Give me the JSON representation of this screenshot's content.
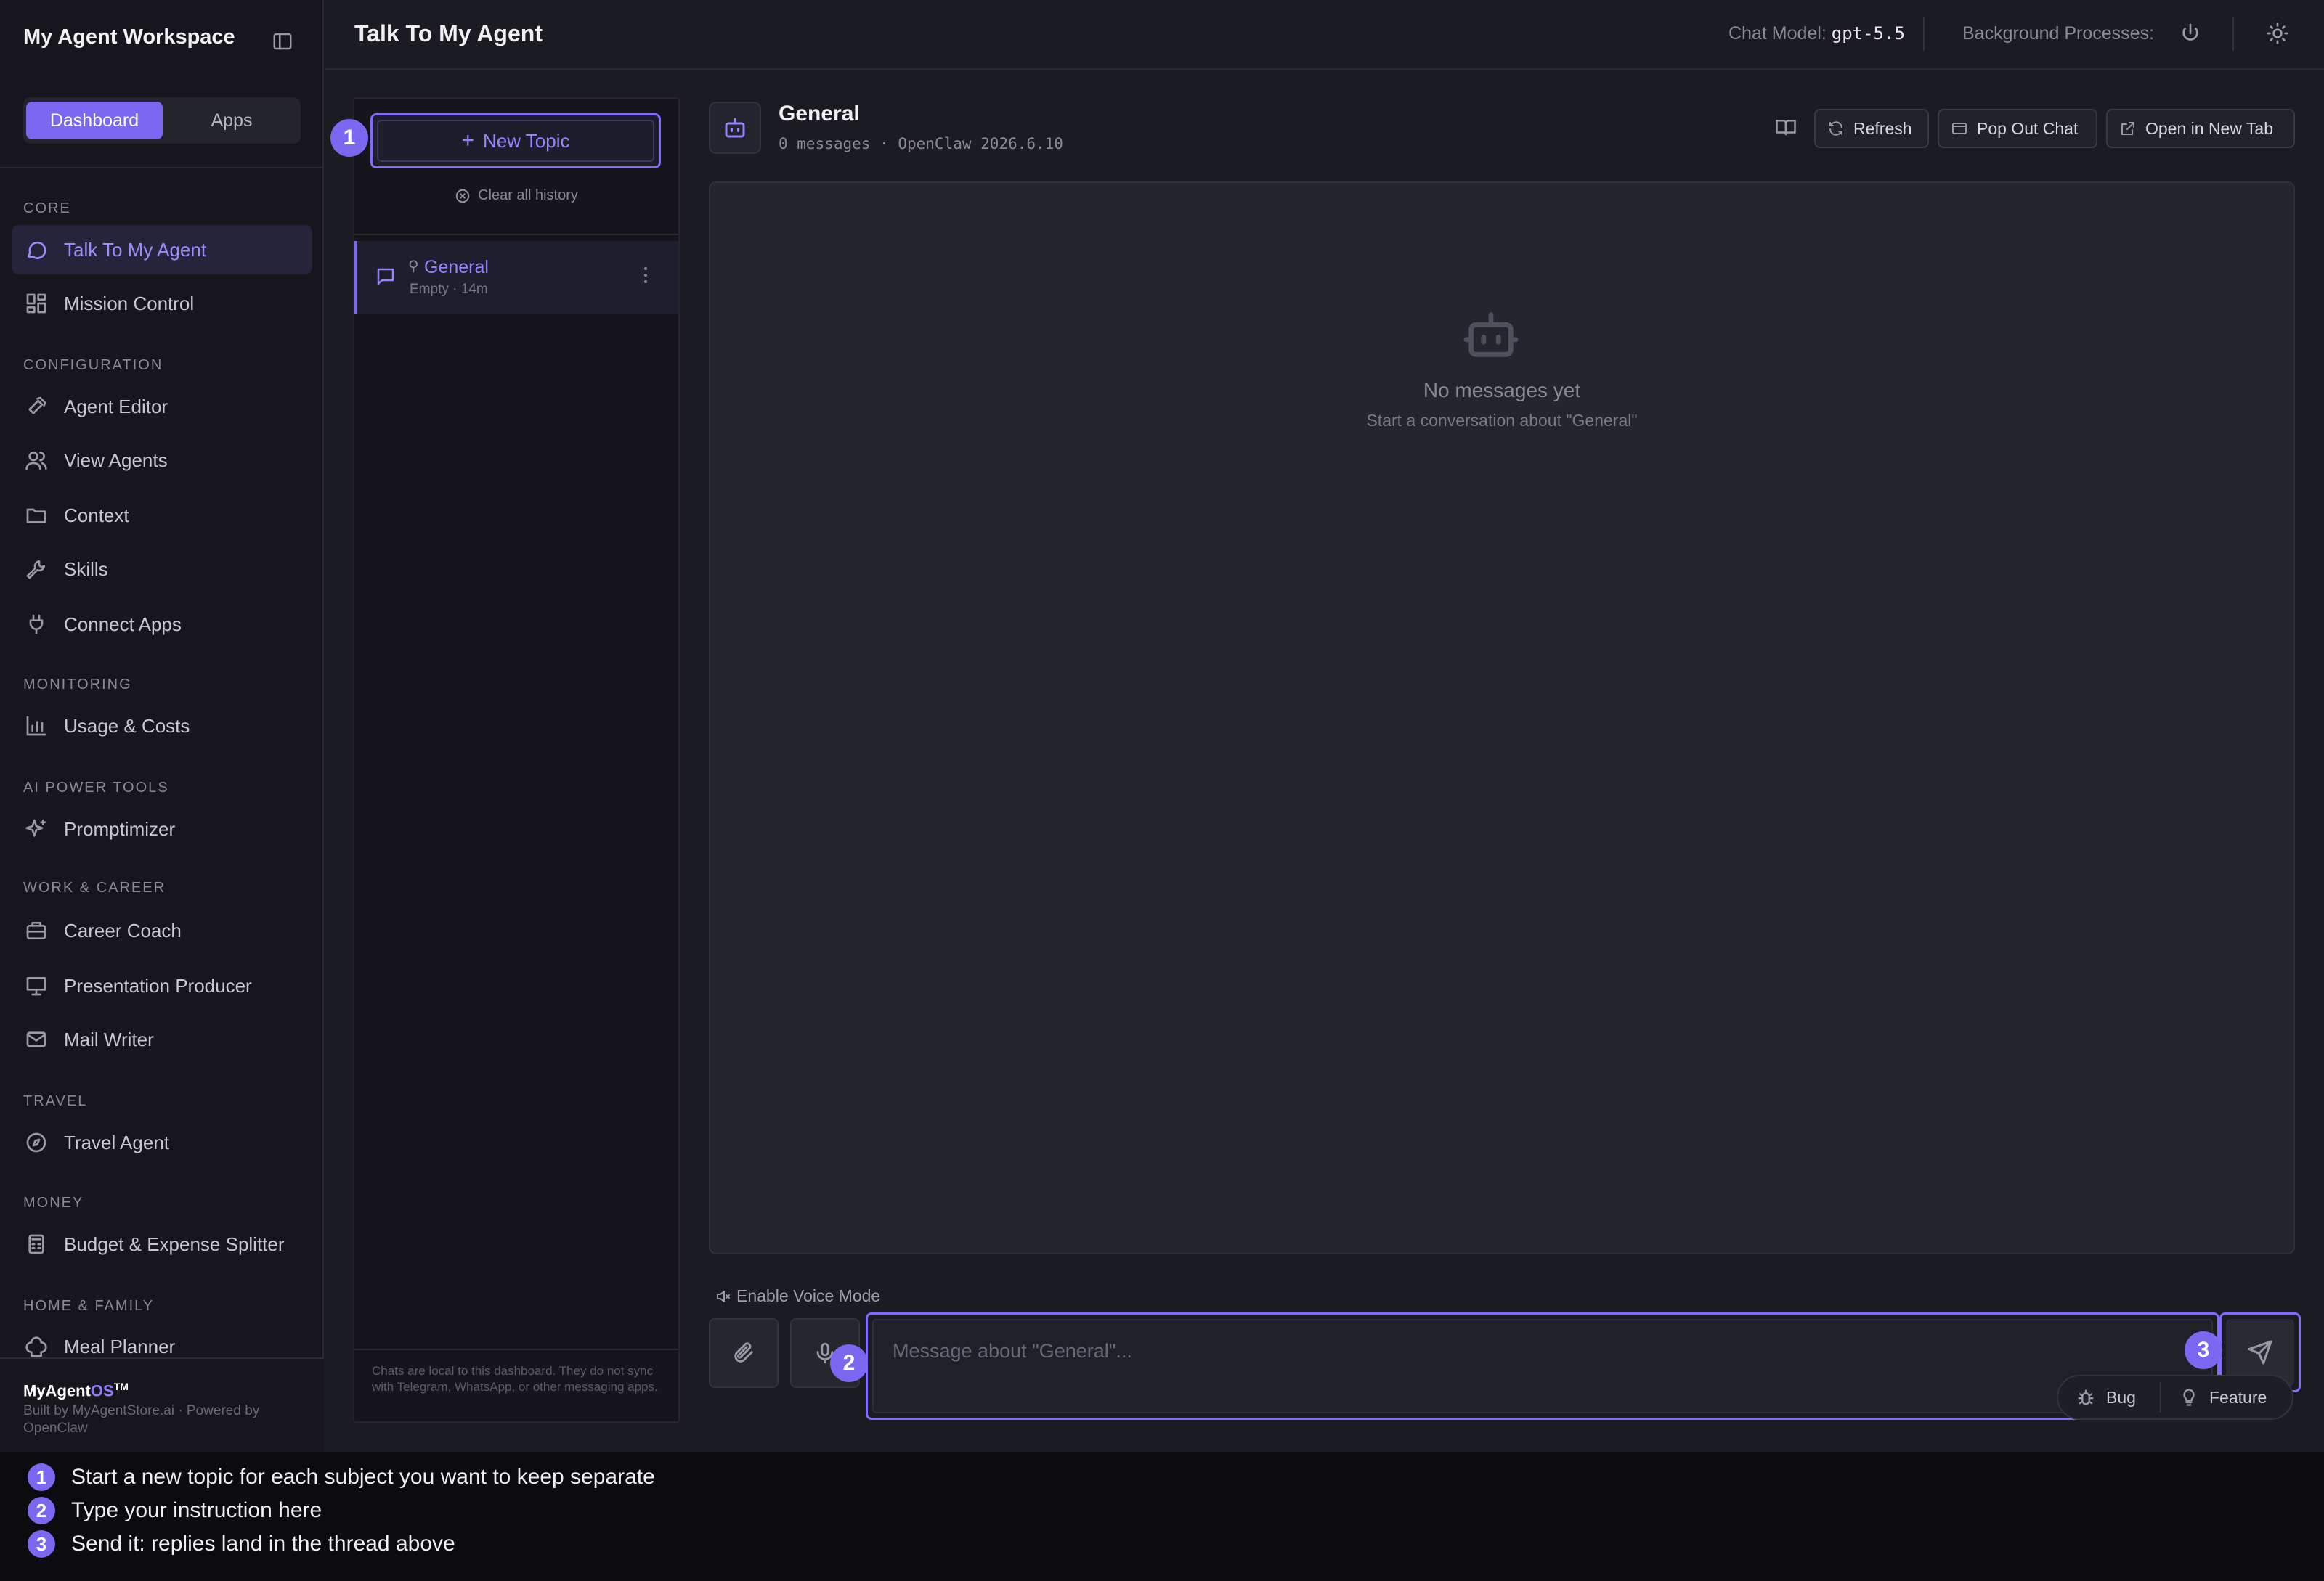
{
  "sidebar": {
    "title": "My Agent Workspace",
    "tabs": {
      "dashboard": "Dashboard",
      "apps": "Apps"
    },
    "sections": [
      {
        "label": "CORE",
        "items": [
          {
            "label": "Talk To My Agent",
            "icon": "message-icon",
            "active": true
          },
          {
            "label": "Mission Control",
            "icon": "grid-icon"
          }
        ]
      },
      {
        "label": "CONFIGURATION",
        "items": [
          {
            "label": "Agent Editor",
            "icon": "hammer-icon"
          },
          {
            "label": "View Agents",
            "icon": "users-icon"
          },
          {
            "label": "Context",
            "icon": "folder-icon"
          },
          {
            "label": "Skills",
            "icon": "wrench-icon"
          },
          {
            "label": "Connect Apps",
            "icon": "plug-icon"
          }
        ]
      },
      {
        "label": "MONITORING",
        "items": [
          {
            "label": "Usage & Costs",
            "icon": "bar-chart-icon"
          }
        ]
      },
      {
        "label": "AI POWER TOOLS",
        "items": [
          {
            "label": "Promptimizer",
            "icon": "sparkles-icon"
          }
        ]
      },
      {
        "label": "WORK & CAREER",
        "items": [
          {
            "label": "Career Coach",
            "icon": "briefcase-icon"
          },
          {
            "label": "Presentation Producer",
            "icon": "presentation-icon"
          },
          {
            "label": "Mail Writer",
            "icon": "mail-icon"
          }
        ]
      },
      {
        "label": "TRAVEL",
        "items": [
          {
            "label": "Travel Agent",
            "icon": "compass-icon"
          }
        ]
      },
      {
        "label": "MONEY",
        "items": [
          {
            "label": "Budget & Expense Splitter",
            "icon": "calculator-icon"
          }
        ]
      },
      {
        "label": "HOME & FAMILY",
        "items": [
          {
            "label": "Meal Planner",
            "icon": "chef-hat-icon"
          }
        ]
      }
    ],
    "footer": {
      "brand_main": "MyAgent",
      "brand_os": "OS",
      "brand_tm": "TM",
      "sub": "Built by MyAgentStore.ai · Powered by OpenClaw"
    }
  },
  "header": {
    "title": "Talk To My Agent",
    "chat_model_label": "Chat Model:",
    "chat_model_value": "gpt-5.5",
    "background_label": "Background Processes:"
  },
  "topics": {
    "new_topic": "New Topic",
    "clear_history": "Clear all history",
    "items": [
      {
        "name": "General",
        "sub": "Empty · 14m"
      }
    ],
    "note": "Chats are local to this dashboard. They do not sync with Telegram, WhatsApp, or other messaging apps."
  },
  "chat": {
    "title": "General",
    "meta": "0 messages · OpenClaw 2026.6.10",
    "actions": {
      "refresh": "Refresh",
      "popout": "Pop Out Chat",
      "newtab": "Open in New Tab"
    },
    "empty_title": "No messages yet",
    "empty_sub": "Start a conversation about \"General\"",
    "voice_mode": "Enable Voice Mode",
    "input_value": "",
    "input_placeholder": "Message about \"General\"...",
    "feedback": {
      "bug": "Bug",
      "feature": "Feature"
    }
  },
  "badges": [
    "1",
    "2",
    "3"
  ],
  "legend": [
    {
      "num": "1",
      "text": "Start a new topic for each subject you want to keep separate"
    },
    {
      "num": "2",
      "text": "Type your instruction here"
    },
    {
      "num": "3",
      "text": "Send it: replies land in the thread above"
    }
  ],
  "colors": {
    "accent": "#7b68f0",
    "background": "#1b1b22",
    "sidebar": "#16161c"
  }
}
